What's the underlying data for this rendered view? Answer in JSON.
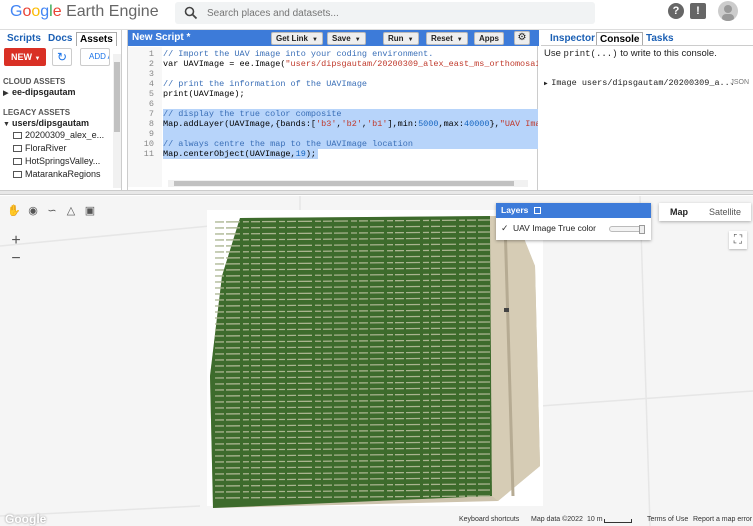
{
  "app": {
    "logo_google": "Google",
    "logo_product": " Earth Engine"
  },
  "search": {
    "placeholder": "Search places and datasets..."
  },
  "left_panel": {
    "tabs": [
      "Scripts",
      "Docs",
      "Assets"
    ],
    "active_tab": "Assets",
    "new_label": "NEW",
    "add_label": "ADD A",
    "cloud_assets_label": "CLOUD ASSETS",
    "cloud_project": "ee-dipsgautam",
    "legacy_assets_label": "LEGACY ASSETS",
    "legacy_root": "users/dipsgautam",
    "legacy_items": [
      "20200309_alex_e...",
      "FloraRiver",
      "HotSpringsValley...",
      "MatarankaRegions"
    ]
  },
  "editor": {
    "title": "New Script *",
    "buttons": [
      "Get Link",
      "Save",
      "Run",
      "Reset",
      "Apps"
    ],
    "line_numbers": [
      "1",
      "2",
      "3",
      "4",
      "5",
      "6",
      "7",
      "8",
      "9",
      "10",
      "11"
    ]
  },
  "right_panel": {
    "tabs": [
      "Inspector",
      "Console",
      "Tasks"
    ],
    "active_tab": "Console",
    "console_hint_prefix": "Use ",
    "console_hint_code": "print(...)",
    "console_hint_suffix": " to write to this console.",
    "console_output": "Image users/dipsgautam/20200309_a...",
    "json_label": "JSON"
  },
  "map": {
    "layers_title": "Layers",
    "layer_name": "UAV Image True color",
    "layer_opacity": 1.0,
    "map_type_options": [
      "Map",
      "Satellite"
    ],
    "map_type_selected": "Map",
    "zoom_in": "+",
    "zoom_out": "−",
    "google_logo": "Google",
    "footer": {
      "shortcuts": "Keyboard shortcuts",
      "map_data": "Map data ©2022",
      "scale": "10 m",
      "terms": "Terms of Use",
      "report": "Report a map error"
    }
  },
  "colors": {
    "accent_blue": "#3d7bd9",
    "new_button_red": "#d93025",
    "selection": "#b7d4fa",
    "vegetation_dark": "#2e5a23",
    "soil_light": "#c9bfa8"
  }
}
